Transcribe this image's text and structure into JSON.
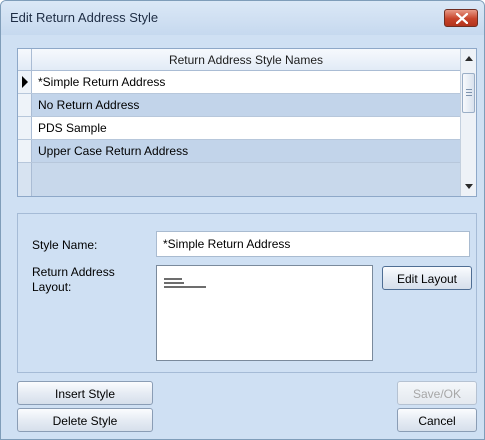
{
  "window": {
    "title": "Edit Return Address Style"
  },
  "grid": {
    "header": "Return Address Style Names",
    "rows": [
      {
        "label": "*Simple Return Address",
        "selected": true
      },
      {
        "label": "No Return Address"
      },
      {
        "label": "PDS Sample"
      },
      {
        "label": "Upper Case Return Address"
      }
    ]
  },
  "form": {
    "style_name_label": "Style Name:",
    "style_name_value": "*Simple Return Address",
    "layout_label_line1": "Return Address",
    "layout_label_line2": "Layout:",
    "edit_layout_label": "Edit Layout"
  },
  "buttons": {
    "insert": "Insert Style",
    "delete": "Delete Style",
    "save": "Save/OK",
    "save_enabled": false,
    "cancel": "Cancel"
  },
  "colors": {
    "window_bg": "#cfe0f3",
    "alt_row": "#c2d4ea",
    "close_button": "#c7432a"
  }
}
